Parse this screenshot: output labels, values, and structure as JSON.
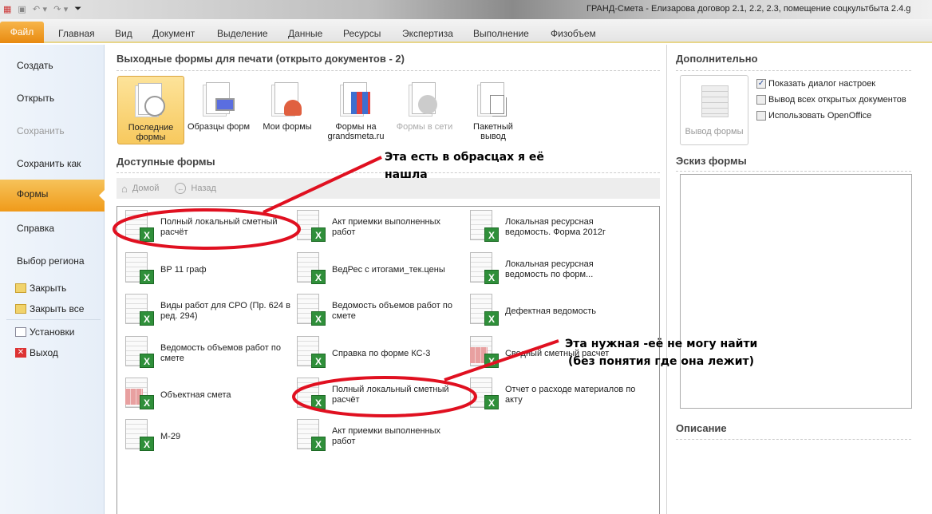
{
  "window": {
    "title": "ГРАНД-Смета - Елизарова договор 2.1, 2.2, 2.3, помещение соцкультбыта 2.4.g"
  },
  "ribbon_tabs": [
    "Файл",
    "Главная",
    "Вид",
    "Документ",
    "Выделение",
    "Данные",
    "Ресурсы",
    "Экспертиза",
    "Выполнение",
    "Физобъем"
  ],
  "sidebar": {
    "items": [
      "Создать",
      "Открыть",
      "Сохранить",
      "Сохранить как",
      "Формы",
      "Справка",
      "Выбор региона"
    ],
    "small_items": [
      "Закрыть",
      "Закрыть все",
      "Установки",
      "Выход"
    ]
  },
  "main": {
    "title": "Выходные формы для печати (открыто документов - 2)",
    "sources": [
      "Последние формы",
      "Образцы форм",
      "Мои формы",
      "Формы на grandsmeta.ru",
      "Формы в сети",
      "Пакетный вывод"
    ],
    "available_title": "Доступные формы",
    "nav": {
      "home": "Домой",
      "back": "Назад"
    },
    "forms": [
      [
        "Полный локальный сметный расчёт",
        "ВР 11 граф",
        "Виды работ для СРО (Пр. 624 в ред. 294)",
        "Ведомость объемов работ по смете",
        "Объектная смета",
        "М-29"
      ],
      [
        "Акт приемки выполненных работ",
        "ВедРес с итогами_тек.цены",
        "Ведомость объемов работ по смете",
        "Справка по форме КС-3",
        "Полный локальный сметный расчёт",
        "Акт приемки выполненных работ"
      ],
      [
        "Локальная ресурсная ведомость. Форма 2012г",
        "Локальная ресурсная ведомость по форм...",
        "Дефектная ведомость",
        "Сводный сметный расчет",
        "Отчет о расходе материалов по акту"
      ]
    ]
  },
  "right": {
    "extra_title": "Дополнительно",
    "output_button": "Вывод формы",
    "checks": [
      {
        "label": "Показать диалог настроек",
        "checked": true
      },
      {
        "label": "Вывод всех открытых документов",
        "checked": false
      },
      {
        "label": "Использовать OpenOffice",
        "checked": false
      }
    ],
    "sketch_title": "Эскиз формы",
    "desc_title": "Описание"
  },
  "annotations": {
    "note1": "Эта есть в обрасцах я её нашла",
    "note2_line1": "Эта нужная -её не могу найти",
    "note2_line2": "(без понятия где она лежит)",
    "color": "#e01020"
  }
}
